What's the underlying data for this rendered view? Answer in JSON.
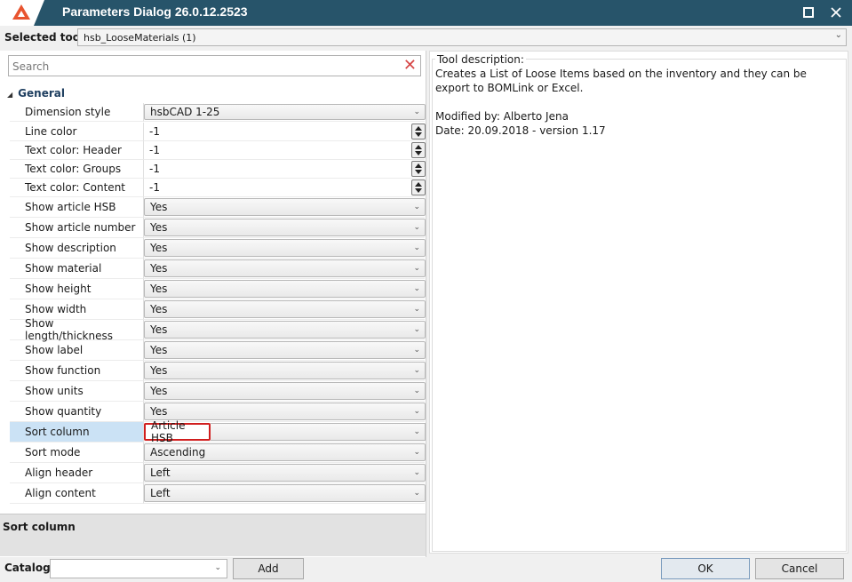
{
  "window": {
    "title": "Parameters Dialog 26.0.12.2523",
    "maximize_icon": "maximize-icon",
    "close_icon": "close-icon"
  },
  "tool_selector": {
    "label": "Selected tool",
    "value": "hsb_LooseMaterials (1)"
  },
  "search": {
    "placeholder": "Search"
  },
  "group": {
    "title": "General"
  },
  "properties": [
    {
      "name": "Dimension style",
      "type": "dropdown",
      "value": "hsbCAD 1-25"
    },
    {
      "name": "Line color",
      "type": "number",
      "value": "-1"
    },
    {
      "name": "Text color: Header",
      "type": "number",
      "value": "-1"
    },
    {
      "name": "Text color: Groups",
      "type": "number",
      "value": "-1"
    },
    {
      "name": "Text color: Content",
      "type": "number",
      "value": "-1"
    },
    {
      "name": "Show article HSB",
      "type": "dropdown",
      "value": "Yes"
    },
    {
      "name": "Show article number",
      "type": "dropdown",
      "value": "Yes"
    },
    {
      "name": "Show description",
      "type": "dropdown",
      "value": "Yes"
    },
    {
      "name": "Show material",
      "type": "dropdown",
      "value": "Yes"
    },
    {
      "name": "Show height",
      "type": "dropdown",
      "value": "Yes"
    },
    {
      "name": "Show width",
      "type": "dropdown",
      "value": "Yes"
    },
    {
      "name": "Show length/thickness",
      "type": "dropdown",
      "value": "Yes"
    },
    {
      "name": "Show label",
      "type": "dropdown",
      "value": "Yes"
    },
    {
      "name": "Show function",
      "type": "dropdown",
      "value": "Yes"
    },
    {
      "name": "Show units",
      "type": "dropdown",
      "value": "Yes"
    },
    {
      "name": "Show quantity",
      "type": "dropdown",
      "value": "Yes"
    },
    {
      "name": "Sort column",
      "type": "dropdown",
      "value": "Article HSB",
      "selected": true
    },
    {
      "name": "Sort mode",
      "type": "dropdown",
      "value": "Ascending"
    },
    {
      "name": "Align header",
      "type": "dropdown",
      "value": "Left"
    },
    {
      "name": "Align content",
      "type": "dropdown",
      "value": "Left"
    }
  ],
  "property_description": {
    "title": "Sort column"
  },
  "tool_description": {
    "legend": "Tool description:",
    "text": "Creates a List of Loose Items based on the inventory and they can be export to BOMLink or Excel.\n\nModified by: Alberto Jena\nDate: 20.09.2018 - version 1.17"
  },
  "footer": {
    "catalog_label": "Catalog",
    "catalog_value": "",
    "add_label": "Add",
    "ok_label": "OK",
    "cancel_label": "Cancel"
  },
  "colors": {
    "titlebar": "#27546a",
    "selected_row": "#cbe2f5",
    "highlight_border": "#d01e1e",
    "logo": "#e8542f"
  }
}
